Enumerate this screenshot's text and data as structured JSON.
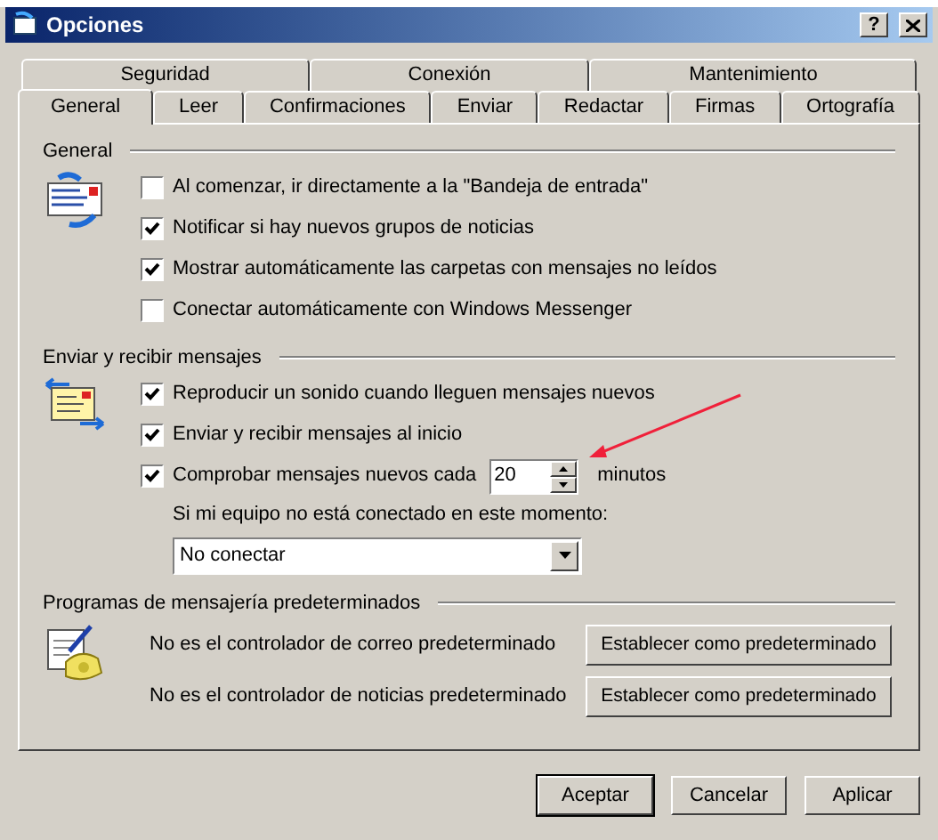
{
  "window": {
    "title": "Opciones",
    "help": "?"
  },
  "tab_rows": [
    [
      {
        "label": "Seguridad",
        "selected": false
      },
      {
        "label": "Conexión",
        "selected": false
      },
      {
        "label": "Mantenimiento",
        "selected": false
      }
    ],
    [
      {
        "label": "General",
        "selected": true
      },
      {
        "label": "Leer",
        "selected": false
      },
      {
        "label": "Confirmaciones",
        "selected": false
      },
      {
        "label": "Enviar",
        "selected": false
      },
      {
        "label": "Redactar",
        "selected": false
      },
      {
        "label": "Firmas",
        "selected": false
      },
      {
        "label": "Ortografía",
        "selected": false
      }
    ]
  ],
  "sections": [
    {
      "title": "General",
      "items": [
        {
          "kind": "checkbox",
          "label": "Al comenzar, ir directamente a la \"Bandeja de entrada\"",
          "checked": false
        },
        {
          "kind": "checkbox",
          "label": "Notificar si hay nuevos grupos de noticias",
          "checked": true
        },
        {
          "kind": "checkbox",
          "label": "Mostrar automáticamente las carpetas con mensajes no leídos",
          "checked": true
        },
        {
          "kind": "checkbox",
          "label": "Conectar automáticamente con Windows Messenger",
          "checked": false
        }
      ]
    },
    {
      "title": "Enviar y recibir mensajes",
      "items": [
        {
          "kind": "checkbox",
          "label": "Reproducir un sonido cuando lleguen mensajes nuevos",
          "checked": true
        },
        {
          "kind": "checkbox",
          "label": "Enviar y recibir mensajes al inicio",
          "checked": true
        },
        {
          "kind": "spinner",
          "label": "Comprobar mensajes nuevos cada",
          "checked": true,
          "value": "20",
          "unit": "minutos"
        },
        {
          "kind": "text",
          "label": "Si mi equipo no está conectado en este momento:"
        },
        {
          "kind": "dropdown",
          "value": "No conectar"
        }
      ]
    },
    {
      "title": "Programas de mensajería predeterminados",
      "items": [
        {
          "kind": "default",
          "label": "No es el controlador de correo predeterminado",
          "button": "Establecer como predeterminado"
        },
        {
          "kind": "default",
          "label": "No es el controlador de noticias predeterminado",
          "button": "Establecer como predeterminado"
        }
      ]
    }
  ],
  "buttons": [
    "Aceptar",
    "Cancelar",
    "Aplicar"
  ]
}
